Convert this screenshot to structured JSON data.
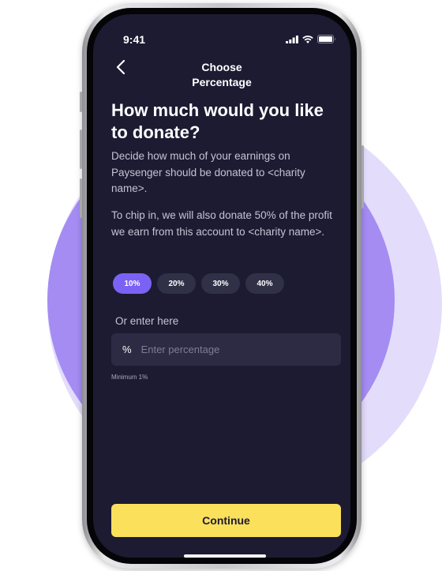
{
  "status_bar": {
    "time": "9:41"
  },
  "nav": {
    "title_line1": "Choose",
    "title_line2": "Percentage"
  },
  "main": {
    "heading": "How much would you like to donate?",
    "description_1": "Decide how much of your earnings on Paysenger should be donated to <charity name>.",
    "description_2": "To chip in, we will also donate 50% of the profit we earn from this account to <charity name>.",
    "chips": [
      {
        "label": "10%",
        "selected": true
      },
      {
        "label": "20%",
        "selected": false
      },
      {
        "label": "30%",
        "selected": false
      },
      {
        "label": "40%",
        "selected": false
      }
    ],
    "or_enter_label": "Or enter here",
    "input": {
      "prefix": "%",
      "value": "",
      "placeholder": "Enter percentage"
    },
    "hint": "Minimum 1%"
  },
  "footer": {
    "continue_label": "Continue"
  },
  "colors": {
    "screen_bg": "#1c1b32",
    "accent_purple": "#7b62f4",
    "button_yellow": "#fbe05c",
    "ring_light": "#e3dcfb",
    "ring_dark": "#a48cf3"
  },
  "icons": [
    "chevron-left-icon",
    "cellular-signal-icon",
    "wifi-icon",
    "battery-icon"
  ]
}
